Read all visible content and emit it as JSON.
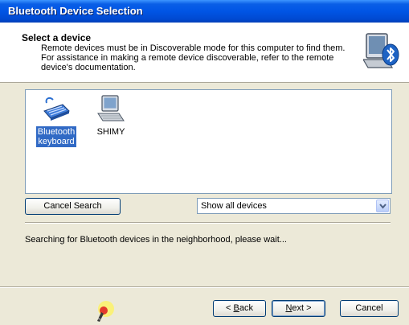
{
  "window": {
    "title": "Bluetooth Device Selection"
  },
  "header": {
    "title": "Select a device",
    "description": "Remote devices must be in Discoverable mode for this computer to find them. For assistance in making a remote device discoverable, refer to the remote device's documentation.",
    "icon": "bluetooth-computer-icon"
  },
  "devices": [
    {
      "label_line1": "Bluetooth",
      "label_line2": "keyboard",
      "icon": "keyboard-icon",
      "selected": true
    },
    {
      "label_line1": "SHIMY",
      "label_line2": "",
      "icon": "computer-icon",
      "selected": false
    }
  ],
  "controls": {
    "cancel_search": "Cancel Search",
    "filter_value": "Show all devices"
  },
  "status_text": "Searching for Bluetooth devices in the neighborhood, please wait...",
  "footer": {
    "back_label": "Back",
    "next_label": "Next",
    "cancel_label": "Cancel",
    "wizard_icon": "wizard-pointer-icon"
  },
  "colors": {
    "selection": "#316ac5",
    "titlebar": "#0055e5",
    "face": "#ece9d8"
  }
}
